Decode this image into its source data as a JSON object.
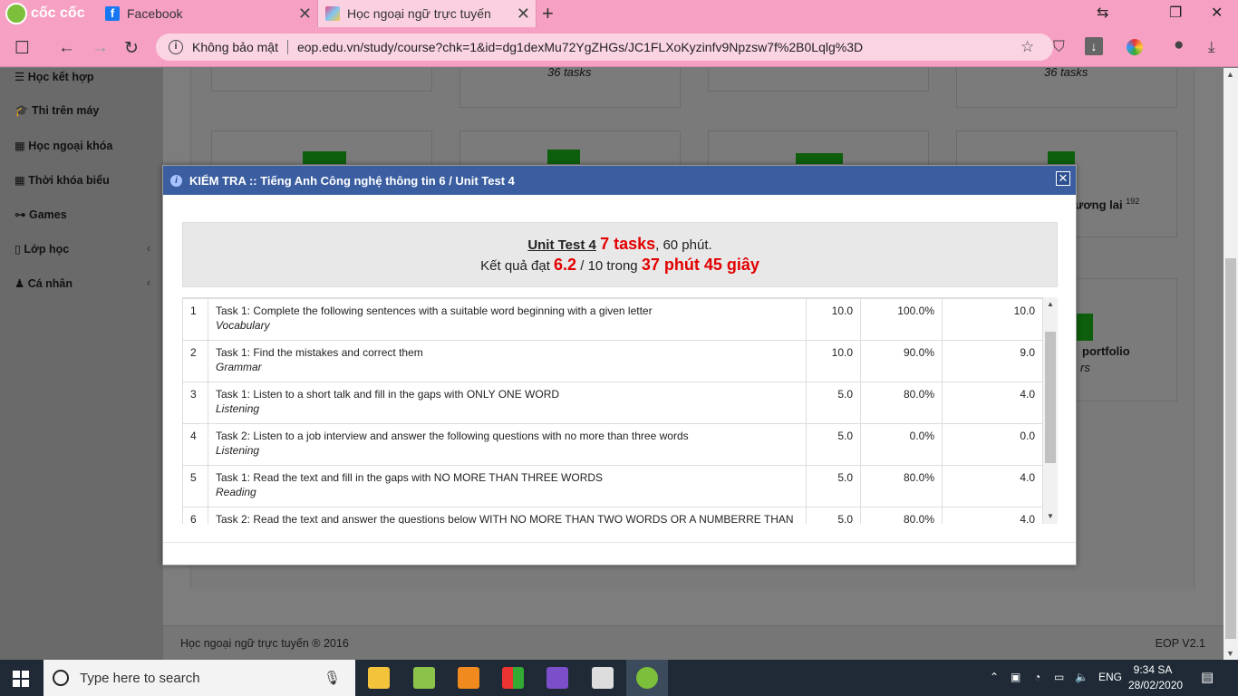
{
  "browser": {
    "brand": "cốc cốc",
    "tabs": [
      {
        "title": "Facebook"
      },
      {
        "title": "Học ngoại ngữ trực tuyến"
      }
    ],
    "security_label": "Không bảo mật",
    "url": "eop.edu.vn/study/course?chk=1&id=dg1dexMu72YgZHGs/JC1FLXoKyzinfv9Npzsw7f%2B0Lqlg%3D"
  },
  "sidebar": {
    "items": [
      {
        "label": "Học kết hợp"
      },
      {
        "label": "Thi trên máy"
      },
      {
        "label": "Học ngoại khóa"
      },
      {
        "label": "Thời khóa biểu"
      },
      {
        "label": "Games"
      },
      {
        "label": "Lớp học"
      },
      {
        "label": "Cá nhân"
      }
    ]
  },
  "background": {
    "card_tasks_1": "36 tasks",
    "card_tasks_2": "36 tasks",
    "card_title_3": "ương lai",
    "card_badge_3": "192",
    "card_title_4": "portfolio",
    "card_sub_4": "rs"
  },
  "modal": {
    "title": "KIỂM TRA :: Tiếng Anh Công nghệ thông tin 6 / Unit Test 4",
    "test_name": "Unit Test 4",
    "tasks_count": "7 tasks",
    "duration": ", 60 phút.",
    "result_prefix": "Kết quả đạt",
    "score": "6.2",
    "score_suffix": "/ 10 trong",
    "time_spent": "37 phút 45 giây",
    "tasks": [
      {
        "no": "1",
        "name": "Task 1: Complete the following sentences with a suitable word beginning with a given letter",
        "category": "Vocabulary",
        "max": "10.0",
        "percent": "100.0%",
        "score": "10.0"
      },
      {
        "no": "2",
        "name": "Task 1: Find the mistakes and correct them",
        "category": "Grammar",
        "max": "10.0",
        "percent": "90.0%",
        "score": "9.0"
      },
      {
        "no": "3",
        "name": "Task 1: Listen to a short talk and fill in the gaps with ONLY ONE WORD",
        "category": "Listening",
        "max": "5.0",
        "percent": "80.0%",
        "score": "4.0"
      },
      {
        "no": "4",
        "name": "Task 2: Listen to a job interview and answer the following questions with no more than three words",
        "category": "Listening",
        "max": "5.0",
        "percent": "0.0%",
        "score": "0.0"
      },
      {
        "no": "5",
        "name": "Task 1: Read the text and fill in the gaps with NO MORE THAN THREE WORDS",
        "category": "Reading",
        "max": "5.0",
        "percent": "80.0%",
        "score": "4.0"
      },
      {
        "no": "6",
        "name": "Task 2: Read the text and answer the questions below WITH NO MORE THAN TWO WORDS OR A NUMBERRE THAN",
        "category": "",
        "max": "5.0",
        "percent": "80.0%",
        "score": "4.0"
      }
    ]
  },
  "footer": {
    "left": "Học ngoại ngữ trực tuyến ® 2016",
    "right": "EOP V2.1"
  },
  "taskbar": {
    "search_placeholder": "Type here to search",
    "lang": "ENG",
    "time": "9:34 SA",
    "date": "28/02/2020"
  }
}
